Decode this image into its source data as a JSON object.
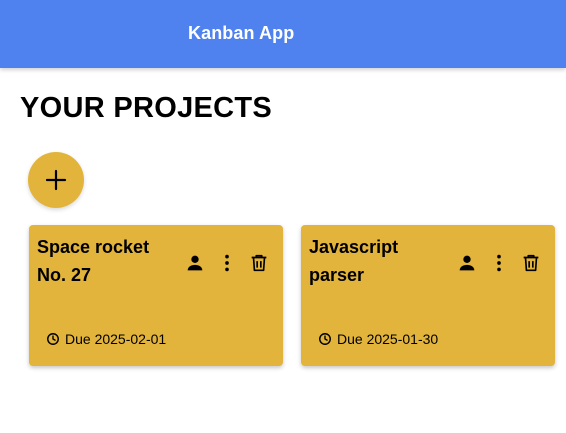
{
  "appbar": {
    "title": "Kanban App",
    "color": "#4f82ee"
  },
  "page": {
    "heading": "YOUR PROJECTS"
  },
  "fab": {
    "icon": "plus-icon",
    "color": "#e2b43c"
  },
  "projects": [
    {
      "title": "Space rocket No. 27",
      "due": "Due 2025-02-01"
    },
    {
      "title": "Javascript parser",
      "due": "Due 2025-01-30"
    }
  ],
  "card_icons": [
    "person-icon",
    "more-vertical-icon",
    "trash-icon",
    "clock-icon"
  ],
  "card_color": "#e2b43c"
}
